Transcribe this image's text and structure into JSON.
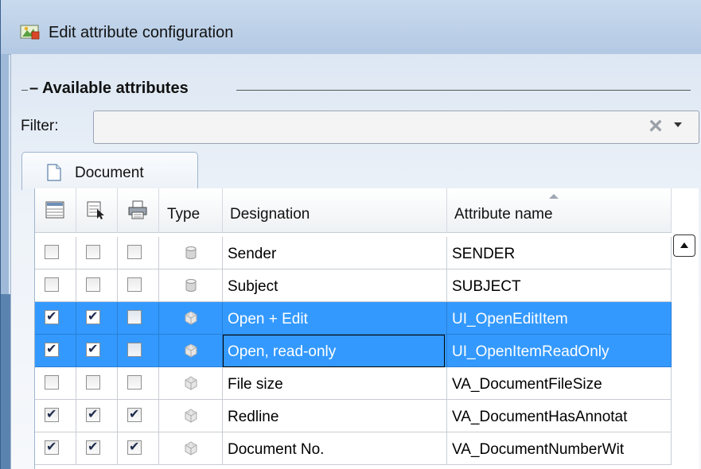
{
  "window": {
    "title": "Edit attribute configuration",
    "icon": "app-icon"
  },
  "group": {
    "title": "– Available attributes"
  },
  "filter": {
    "label": "Filter:",
    "value": "",
    "placeholder": "",
    "clear_icon": "×"
  },
  "tab": {
    "label": "Document",
    "icon": "document-icon"
  },
  "table": {
    "columns": [
      {
        "icon": "list-view-icon"
      },
      {
        "icon": "select-cursor-icon"
      },
      {
        "icon": "print-icon"
      },
      {
        "label": "Type"
      },
      {
        "label": "Designation"
      },
      {
        "label": "Attribute name",
        "sorted": "ascending"
      }
    ],
    "rows": [
      {
        "c1": false,
        "c2": false,
        "c3": false,
        "type": "field",
        "designation": "Sender",
        "attribute": "SENDER",
        "selected": false
      },
      {
        "c1": false,
        "c2": false,
        "c3": false,
        "type": "field",
        "designation": "Subject",
        "attribute": "SUBJECT",
        "selected": false
      },
      {
        "c1": true,
        "c2": true,
        "c3": false,
        "type": "virtual",
        "designation": "Open + Edit",
        "attribute": "UI_OpenEditItem",
        "selected": true
      },
      {
        "c1": true,
        "c2": true,
        "c3": false,
        "type": "virtual",
        "designation": "Open, read-only",
        "attribute": "UI_OpenItemReadOnly",
        "selected": true
      },
      {
        "c1": false,
        "c2": false,
        "c3": false,
        "type": "virtual",
        "designation": "File size",
        "attribute": "VA_DocumentFileSize",
        "selected": false
      },
      {
        "c1": true,
        "c2": true,
        "c3": true,
        "type": "virtual",
        "designation": "Redline",
        "attribute": "VA_DocumentHasAnnotat",
        "selected": false
      },
      {
        "c1": true,
        "c2": true,
        "c3": true,
        "type": "virtual",
        "designation": "Document No.",
        "attribute": "VA_DocumentNumberWit",
        "selected": false
      }
    ]
  },
  "colors": {
    "selection": "#3399ff",
    "title_bar": "#b3c9e3"
  }
}
